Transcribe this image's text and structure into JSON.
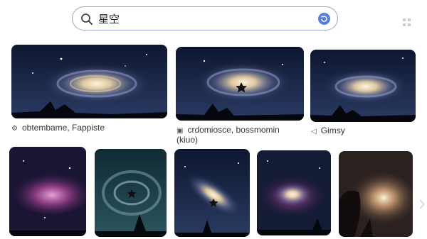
{
  "search": {
    "query": "星空"
  },
  "results": {
    "row1_captions": [
      {
        "icon": "settings-icon",
        "text": "obtembame, Fappiste"
      },
      {
        "icon": "image-icon",
        "text": "crdomiosce, bossmomin",
        "text2": "(kiuo)"
      },
      {
        "icon": "chevron-left-icon",
        "text": "Gimsy"
      }
    ]
  },
  "colors": {
    "accent": "#5a7fd6",
    "border": "#9aa6c8"
  }
}
